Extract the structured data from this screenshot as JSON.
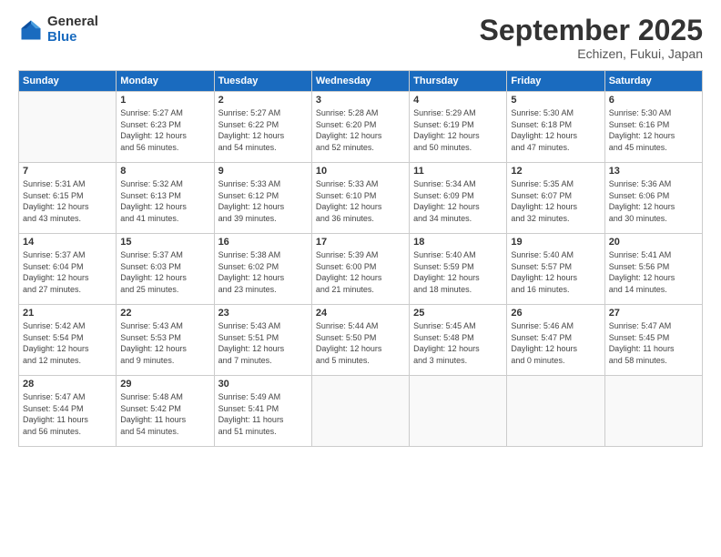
{
  "logo": {
    "general": "General",
    "blue": "Blue"
  },
  "header": {
    "month": "September 2025",
    "location": "Echizen, Fukui, Japan"
  },
  "weekdays": [
    "Sunday",
    "Monday",
    "Tuesday",
    "Wednesday",
    "Thursday",
    "Friday",
    "Saturday"
  ],
  "weeks": [
    [
      {
        "day": "",
        "info": ""
      },
      {
        "day": "1",
        "info": "Sunrise: 5:27 AM\nSunset: 6:23 PM\nDaylight: 12 hours\nand 56 minutes."
      },
      {
        "day": "2",
        "info": "Sunrise: 5:27 AM\nSunset: 6:22 PM\nDaylight: 12 hours\nand 54 minutes."
      },
      {
        "day": "3",
        "info": "Sunrise: 5:28 AM\nSunset: 6:20 PM\nDaylight: 12 hours\nand 52 minutes."
      },
      {
        "day": "4",
        "info": "Sunrise: 5:29 AM\nSunset: 6:19 PM\nDaylight: 12 hours\nand 50 minutes."
      },
      {
        "day": "5",
        "info": "Sunrise: 5:30 AM\nSunset: 6:18 PM\nDaylight: 12 hours\nand 47 minutes."
      },
      {
        "day": "6",
        "info": "Sunrise: 5:30 AM\nSunset: 6:16 PM\nDaylight: 12 hours\nand 45 minutes."
      }
    ],
    [
      {
        "day": "7",
        "info": "Sunrise: 5:31 AM\nSunset: 6:15 PM\nDaylight: 12 hours\nand 43 minutes."
      },
      {
        "day": "8",
        "info": "Sunrise: 5:32 AM\nSunset: 6:13 PM\nDaylight: 12 hours\nand 41 minutes."
      },
      {
        "day": "9",
        "info": "Sunrise: 5:33 AM\nSunset: 6:12 PM\nDaylight: 12 hours\nand 39 minutes."
      },
      {
        "day": "10",
        "info": "Sunrise: 5:33 AM\nSunset: 6:10 PM\nDaylight: 12 hours\nand 36 minutes."
      },
      {
        "day": "11",
        "info": "Sunrise: 5:34 AM\nSunset: 6:09 PM\nDaylight: 12 hours\nand 34 minutes."
      },
      {
        "day": "12",
        "info": "Sunrise: 5:35 AM\nSunset: 6:07 PM\nDaylight: 12 hours\nand 32 minutes."
      },
      {
        "day": "13",
        "info": "Sunrise: 5:36 AM\nSunset: 6:06 PM\nDaylight: 12 hours\nand 30 minutes."
      }
    ],
    [
      {
        "day": "14",
        "info": "Sunrise: 5:37 AM\nSunset: 6:04 PM\nDaylight: 12 hours\nand 27 minutes."
      },
      {
        "day": "15",
        "info": "Sunrise: 5:37 AM\nSunset: 6:03 PM\nDaylight: 12 hours\nand 25 minutes."
      },
      {
        "day": "16",
        "info": "Sunrise: 5:38 AM\nSunset: 6:02 PM\nDaylight: 12 hours\nand 23 minutes."
      },
      {
        "day": "17",
        "info": "Sunrise: 5:39 AM\nSunset: 6:00 PM\nDaylight: 12 hours\nand 21 minutes."
      },
      {
        "day": "18",
        "info": "Sunrise: 5:40 AM\nSunset: 5:59 PM\nDaylight: 12 hours\nand 18 minutes."
      },
      {
        "day": "19",
        "info": "Sunrise: 5:40 AM\nSunset: 5:57 PM\nDaylight: 12 hours\nand 16 minutes."
      },
      {
        "day": "20",
        "info": "Sunrise: 5:41 AM\nSunset: 5:56 PM\nDaylight: 12 hours\nand 14 minutes."
      }
    ],
    [
      {
        "day": "21",
        "info": "Sunrise: 5:42 AM\nSunset: 5:54 PM\nDaylight: 12 hours\nand 12 minutes."
      },
      {
        "day": "22",
        "info": "Sunrise: 5:43 AM\nSunset: 5:53 PM\nDaylight: 12 hours\nand 9 minutes."
      },
      {
        "day": "23",
        "info": "Sunrise: 5:43 AM\nSunset: 5:51 PM\nDaylight: 12 hours\nand 7 minutes."
      },
      {
        "day": "24",
        "info": "Sunrise: 5:44 AM\nSunset: 5:50 PM\nDaylight: 12 hours\nand 5 minutes."
      },
      {
        "day": "25",
        "info": "Sunrise: 5:45 AM\nSunset: 5:48 PM\nDaylight: 12 hours\nand 3 minutes."
      },
      {
        "day": "26",
        "info": "Sunrise: 5:46 AM\nSunset: 5:47 PM\nDaylight: 12 hours\nand 0 minutes."
      },
      {
        "day": "27",
        "info": "Sunrise: 5:47 AM\nSunset: 5:45 PM\nDaylight: 11 hours\nand 58 minutes."
      }
    ],
    [
      {
        "day": "28",
        "info": "Sunrise: 5:47 AM\nSunset: 5:44 PM\nDaylight: 11 hours\nand 56 minutes."
      },
      {
        "day": "29",
        "info": "Sunrise: 5:48 AM\nSunset: 5:42 PM\nDaylight: 11 hours\nand 54 minutes."
      },
      {
        "day": "30",
        "info": "Sunrise: 5:49 AM\nSunset: 5:41 PM\nDaylight: 11 hours\nand 51 minutes."
      },
      {
        "day": "",
        "info": ""
      },
      {
        "day": "",
        "info": ""
      },
      {
        "day": "",
        "info": ""
      },
      {
        "day": "",
        "info": ""
      }
    ]
  ]
}
